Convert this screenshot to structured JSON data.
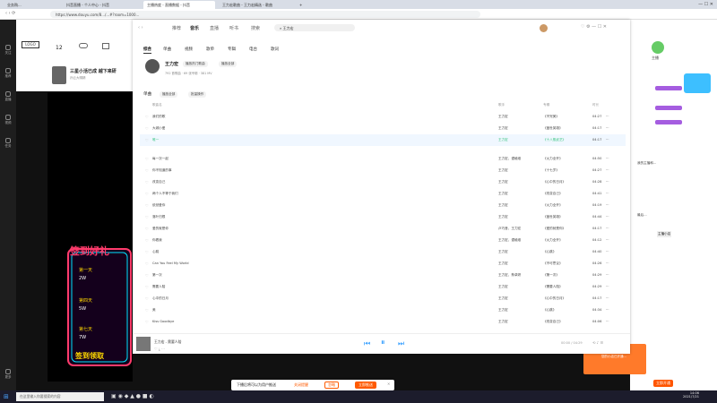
{
  "browser": {
    "tabs": [
      "业务购...",
      "抖音直播 - 个人中心 - 抖音",
      "主播热度 - 直播数据 - 抖音",
      "王力宏歌曲 - 王力宏精选 - 歌曲",
      "+"
    ],
    "url": "https://www.douyu.com/8.../...#?room=1000..."
  },
  "left_rail": [
    "关注",
    "推荐",
    "直播",
    "视频",
    "任务",
    "更多"
  ],
  "stream_header": {
    "follow_count": "12",
    "title": "三星小活已成 越下来研",
    "subtitle": "孙云大嘴精",
    "promo_title": "签到好礼",
    "promo_days": [
      "第一天",
      "第四天",
      "第七天"
    ],
    "promo_values": [
      "2W",
      "5W",
      "7W"
    ],
    "promo_button": "签到领取"
  },
  "music": {
    "nav": [
      "推荐",
      "音乐",
      "直播",
      "听书",
      "搜索"
    ],
    "search": "王力宏",
    "tabs": [
      "综合",
      "单曲",
      "视频",
      "歌单",
      "专辑",
      "电台",
      "歌词"
    ],
    "artist_name": "王力宏",
    "artist_buttons": [
      "播放热门歌曲",
      "播放全部"
    ],
    "stats": "792 首歌曲 · 69 张专辑 · 381 MV",
    "section": "单曲",
    "section_buttons": [
      "播放全部",
      "批量操作"
    ],
    "columns": [
      "歌曲名",
      "歌手",
      "专辑",
      "时长"
    ],
    "rows": [
      {
        "title": "我们的歌",
        "artist": "王力宏",
        "album": "《不完美》",
        "dur": "04:27"
      },
      {
        "title": "大城小爱",
        "artist": "王力宏",
        "album": "《盖世英雄》",
        "dur": "04:17"
      },
      {
        "title": "唯一",
        "artist": "王力宏",
        "album": "《十八般武艺》",
        "dur": "04:17"
      },
      {
        "title": "每一次一起",
        "artist": "王力宏、谭维维",
        "album": "《火力全开》",
        "dur": "04:50"
      },
      {
        "title": "你不知道的事",
        "artist": "王力宏",
        "album": "《十七岁》",
        "dur": "04:27"
      },
      {
        "title": "改变自己",
        "artist": "王力宏",
        "album": "《心中的日月》",
        "dur": "04:28"
      },
      {
        "title": "两个人不等于我们",
        "artist": "王力宏",
        "album": "《改变自己》",
        "dur": "04:41"
      },
      {
        "title": "依然爱你",
        "artist": "王力宏",
        "album": "《火力全开》",
        "dur": "04:19"
      },
      {
        "title": "落叶归根",
        "artist": "王力宏",
        "album": "《盖世英雄》",
        "dur": "04:44"
      },
      {
        "title": "爱的就是你",
        "artist": "卢巧音、王力宏",
        "album": "《爱的就是你》",
        "dur": "04:17"
      },
      {
        "title": "你看我",
        "artist": "王力宏、谭维维",
        "album": "《火力全开》",
        "dur": "04:12"
      },
      {
        "title": "心跳",
        "artist": "王力宏",
        "album": "《心跳》",
        "dur": "04:40"
      },
      {
        "title": "Can You Feel My World",
        "artist": "王力宏",
        "album": "《不可思议》",
        "dur": "04:26"
      },
      {
        "title": "第一次",
        "artist": "王力宏、蔡卓妍",
        "album": "《第一次》",
        "dur": "04:29"
      },
      {
        "title": "需要人陪",
        "artist": "王力宏",
        "album": "《需要人陪》",
        "dur": "04:29"
      },
      {
        "title": "心中的日月",
        "artist": "王力宏",
        "album": "《心中的日月》",
        "dur": "04:17"
      },
      {
        "title": "美",
        "artist": "王力宏",
        "album": "《心跳》",
        "dur": "04:34"
      },
      {
        "title": "Kiss Goodbye",
        "artist": "王力宏",
        "album": "《改变自己》",
        "dur": "04:06"
      }
    ],
    "player_title": "王力宏 - 需要人陪",
    "time": "00:00 / 04:29"
  },
  "right_panel": {
    "name": "主播",
    "texts": [
      "我的主播和...",
      "最后..."
    ],
    "badge": "主播小店",
    "ad_title": "抖音小店",
    "ad_text": "您的小店已开通...",
    "ad_button": "立即开通"
  },
  "notice": {
    "text": "下播后将可以为用户推送",
    "link": "关闭提醒",
    "btn1": "忽略",
    "btn2": "立即推送"
  },
  "taskbar": {
    "search_placeholder": "在这里输入你要搜索的内容",
    "time": "14:06",
    "date": "2021/7/21"
  }
}
